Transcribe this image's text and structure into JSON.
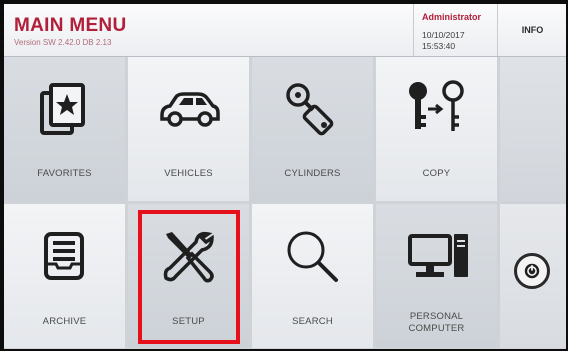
{
  "header": {
    "title": "MAIN MENU",
    "version": "Version SW 2.42.0 DB 2.13",
    "user": "Administrator",
    "date": "10/10/2017",
    "time": "15:53:40",
    "info_label": "INFO"
  },
  "tiles": [
    {
      "label": "FAVORITES",
      "icon": "favorites-icon"
    },
    {
      "label": "VEHICLES",
      "icon": "car-icon"
    },
    {
      "label": "CYLINDERS",
      "icon": "key-cylinder-icon"
    },
    {
      "label": "COPY",
      "icon": "key-copy-icon"
    },
    {
      "label": "ARCHIVE",
      "icon": "archive-tray-icon"
    },
    {
      "label": "SETUP",
      "icon": "wrench-screwdriver-icon"
    },
    {
      "label": "SEARCH",
      "icon": "magnifier-icon"
    },
    {
      "label": "PERSONAL",
      "label2": "COMPUTER",
      "icon": "computer-icon"
    }
  ],
  "power_button": {
    "icon": "power-icon"
  },
  "colors": {
    "title": "#b21f3a",
    "highlight": "#e5101a",
    "icon": "#1f1f1f"
  }
}
